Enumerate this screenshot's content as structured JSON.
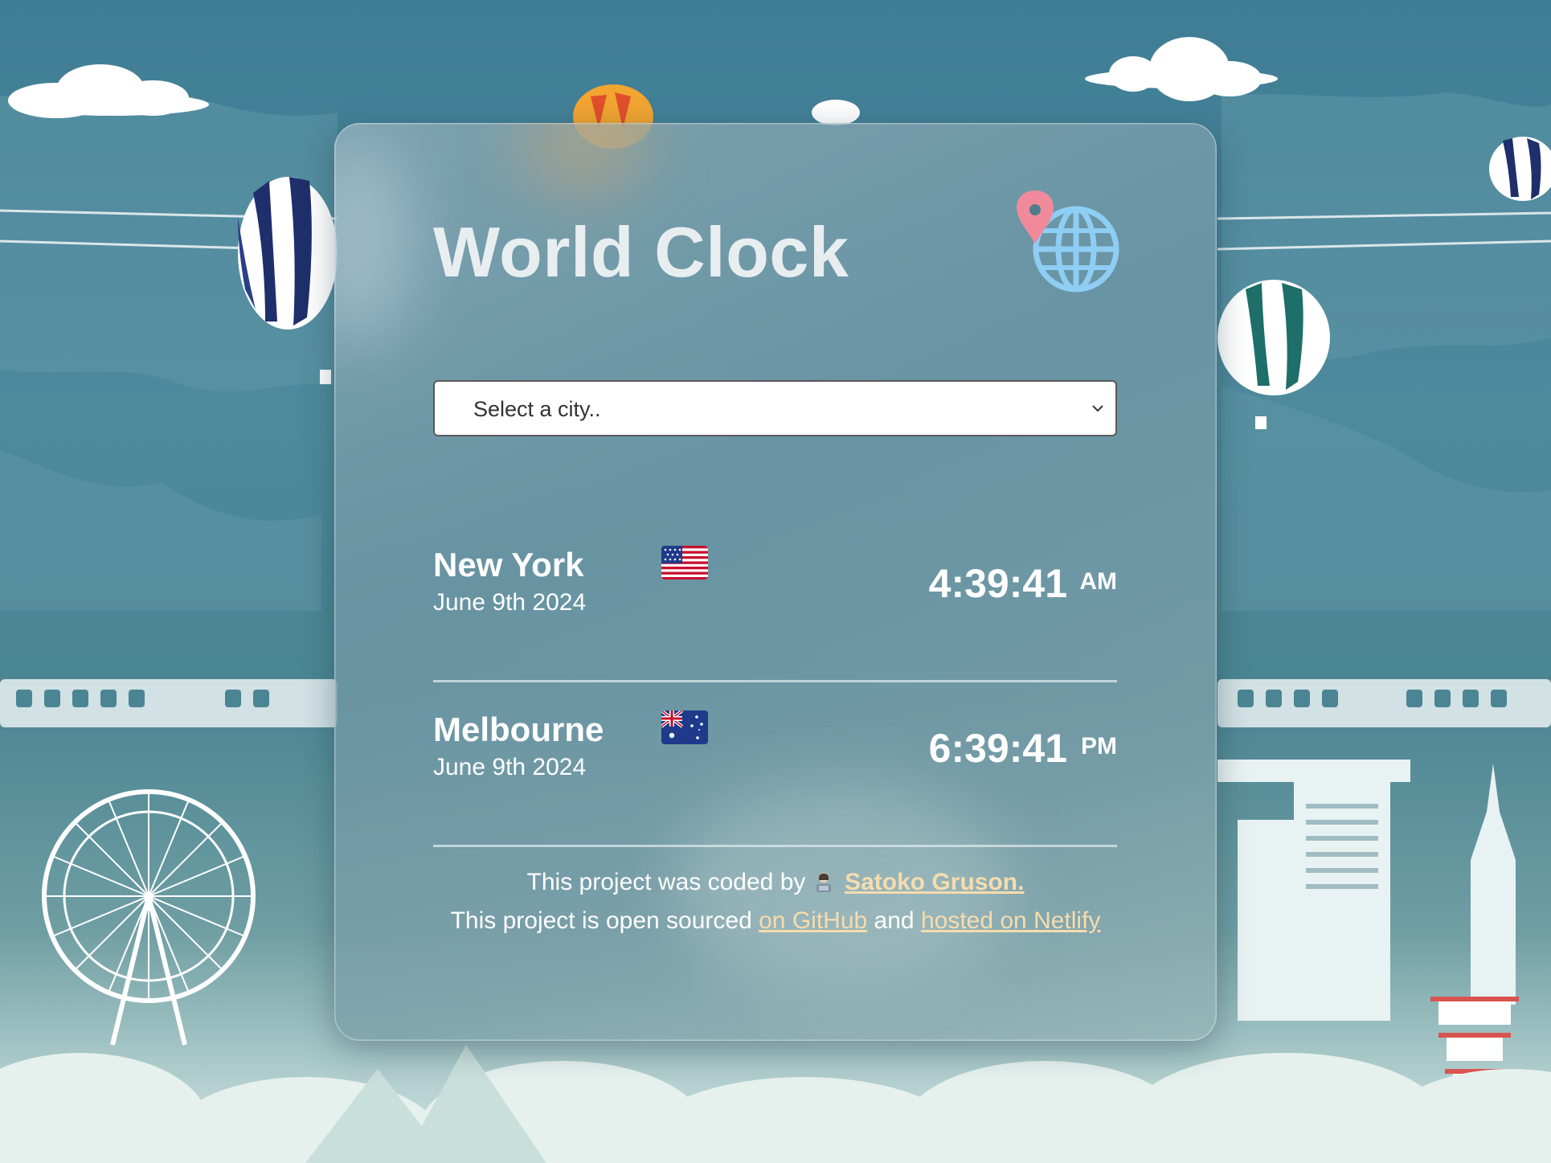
{
  "app": {
    "title": "World Clock"
  },
  "city_select": {
    "placeholder": "Select a city.."
  },
  "cities": [
    {
      "name": "New York",
      "date": "June 9th 2024",
      "time": "4:39:41",
      "period": "AM",
      "flag": "us-flag-icon"
    },
    {
      "name": "Melbourne",
      "date": "June 9th 2024",
      "time": "6:39:41",
      "period": "PM",
      "flag": "australia-flag-icon"
    }
  ],
  "footer": {
    "line1_prefix": "This project was coded by",
    "author_link": "Satoko Gruson.",
    "line2_prefix": "This project is open sourced",
    "github_link": "on GitHub",
    "and_text": "and",
    "netlify_link": "hosted on Netlify"
  },
  "colors": {
    "title": "#e8eef0",
    "link": "#f6dcae",
    "pin": "#f08a9a",
    "globe": "#8ecdf4"
  }
}
